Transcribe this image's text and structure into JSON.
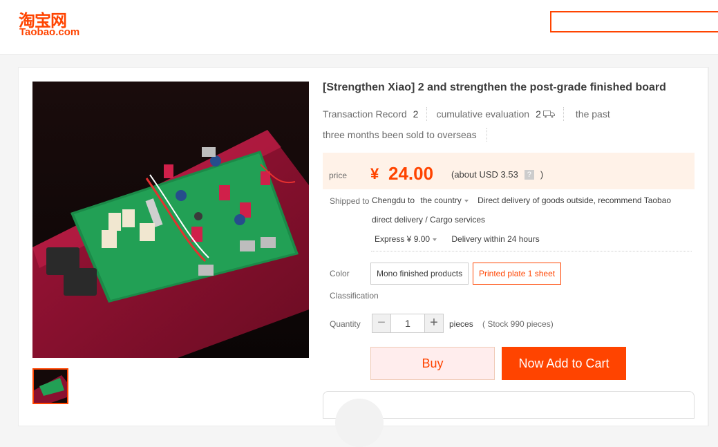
{
  "header": {
    "logo_cn": "淘宝网",
    "logo_en": "Taobao.com",
    "search_placeholder": ""
  },
  "product": {
    "title": "[Strengthen Xiao] 2 and strengthen the post-grade finished board",
    "transaction_label": "Transaction Record",
    "transaction_count": "2",
    "evaluation_label": "cumulative evaluation",
    "evaluation_count": "2",
    "overseas_line1": "the past",
    "overseas_line2": "three months been sold to overseas"
  },
  "price": {
    "label": "price",
    "symbol": "¥",
    "value": "24.00",
    "usd_prefix": "(about USD 3.53",
    "help": "?",
    "usd_suffix": ")"
  },
  "shipping": {
    "label": "Shipped to",
    "from": "Chengdu to",
    "destination": "the country",
    "note_line1": "Direct delivery of goods outside, recommend Taobao",
    "note_line2": "direct delivery / Cargo services",
    "method": "Express ¥ 9.00",
    "delivery_time": "Delivery within 24 hours"
  },
  "options": {
    "color_label": "Color",
    "classification_label": "Classification",
    "choices": [
      {
        "label": "Mono finished products"
      },
      {
        "label": "Printed plate 1 sheet"
      }
    ]
  },
  "quantity": {
    "label": "Quantity",
    "minus": "−",
    "value": "1",
    "plus": "+",
    "unit": "pieces",
    "stock": "( Stock 990 pieces)"
  },
  "actions": {
    "buy": "Buy",
    "add_to_cart": "Now Add to Cart"
  },
  "colors": {
    "accent": "#ff4400",
    "price_bg": "#fff2e8"
  }
}
